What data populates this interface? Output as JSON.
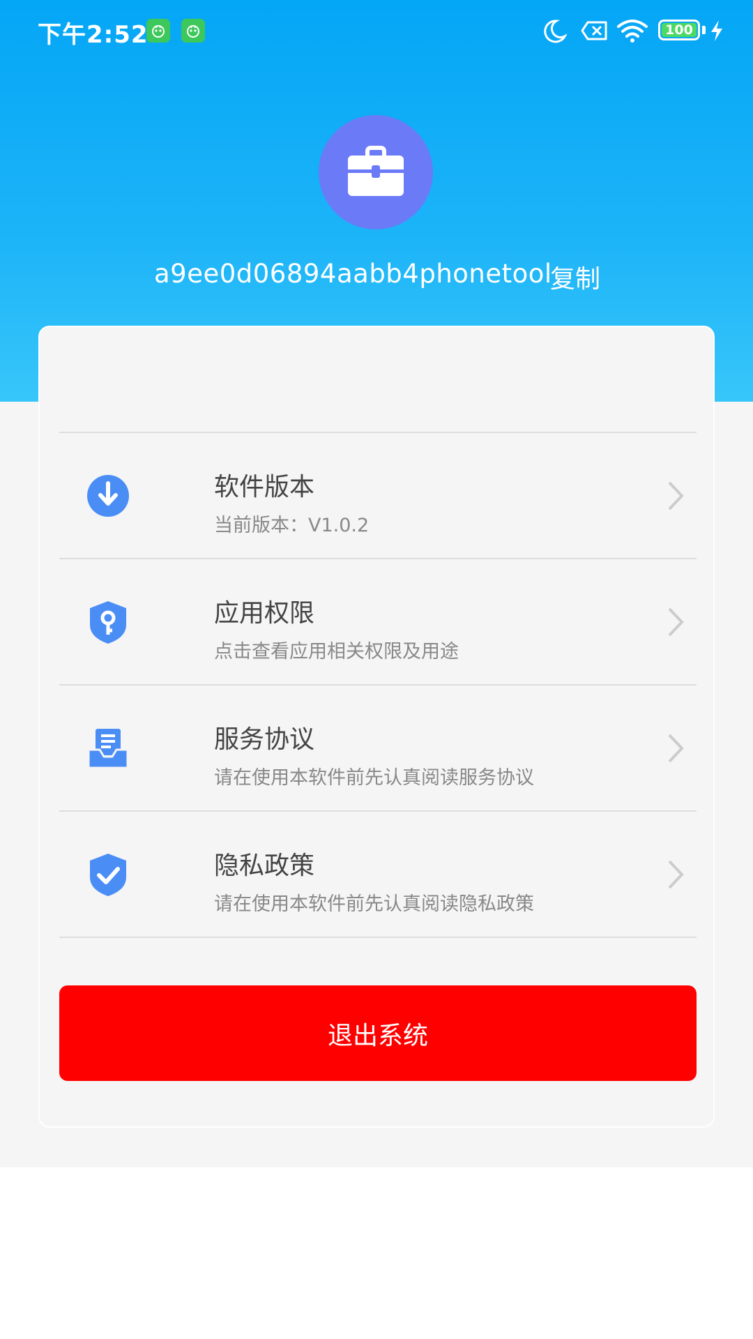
{
  "status_bar": {
    "time": "下午2:52",
    "battery_level": "100",
    "icons": [
      "app-notification-icon",
      "app-notification-icon",
      "moon-icon",
      "sim-error-icon",
      "wifi-icon",
      "battery-icon",
      "charging-icon"
    ]
  },
  "profile": {
    "avatar_icon": "briefcase-icon",
    "device_id": "a9ee0d06894aabb4phonetool",
    "copy_label": "复制"
  },
  "menu": {
    "items": [
      {
        "icon": "download-icon",
        "title": "软件版本",
        "subtitle": "当前版本：V1.0.2"
      },
      {
        "icon": "shield-key-icon",
        "title": "应用权限",
        "subtitle": "点击查看应用相关权限及用途"
      },
      {
        "icon": "document-tray-icon",
        "title": "服务协议",
        "subtitle": "请在使用本软件前先认真阅读服务协议"
      },
      {
        "icon": "shield-check-icon",
        "title": "隐私政策",
        "subtitle": "请在使用本软件前先认真阅读隐私政策"
      }
    ]
  },
  "logout": {
    "label": "退出系统"
  },
  "colors": {
    "header_top": "#04a6f6",
    "header_bottom": "#38c6fa",
    "avatar_bg": "#6b7af7",
    "icon_blue": "#4a8ef5",
    "logout_red": "#ff0000",
    "page_bg": "#f5f5f5"
  }
}
